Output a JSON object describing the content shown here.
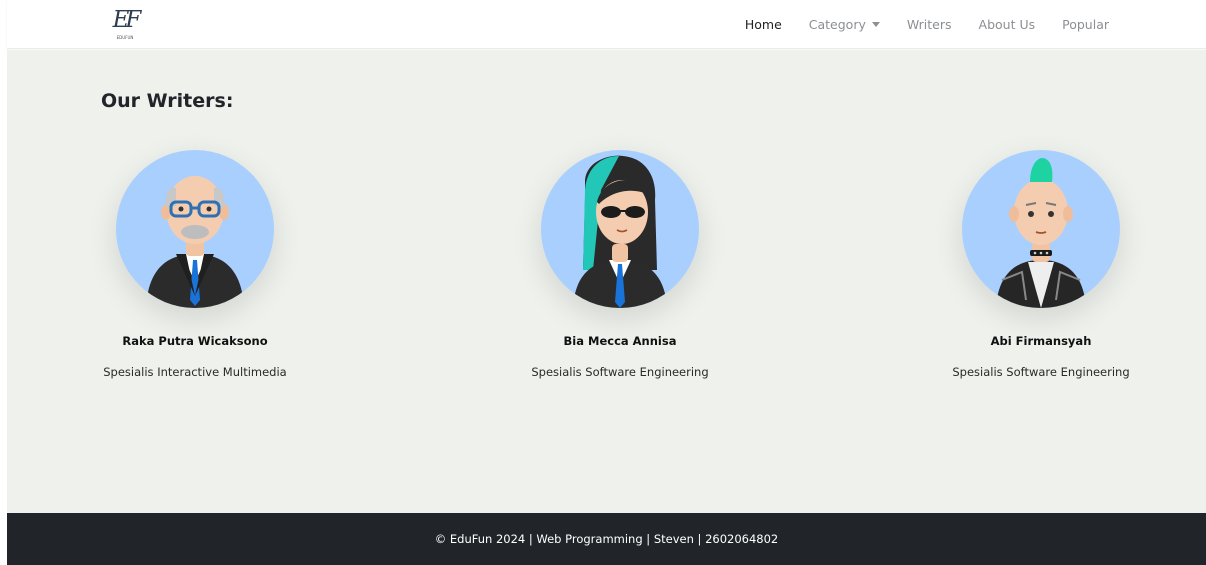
{
  "brand": {
    "mark": "EF",
    "sub": "EDUFUN"
  },
  "nav": [
    {
      "label": "Home",
      "active": true
    },
    {
      "label": "Category",
      "active": false
    },
    {
      "label": "Writers",
      "active": false
    },
    {
      "label": "About Us",
      "active": false
    },
    {
      "label": "Popular",
      "active": false
    }
  ],
  "heading": "Our Writers:",
  "writers": [
    {
      "name": "Raka Putra Wicaksono",
      "role": "Spesialis Interactive Multimedia"
    },
    {
      "name": "Bia Mecca Annisa",
      "role": "Spesialis Software Engineering"
    },
    {
      "name": "Abi Firmansyah",
      "role": "Spesialis Software Engineering"
    }
  ],
  "footer": {
    "text": "© EduFun 2024 | Web Programming | Steven | 2602064802"
  },
  "colors": {
    "avatar_bg": "#a9cfff",
    "main_bg": "#eef1ec",
    "footer_bg": "#212529"
  }
}
